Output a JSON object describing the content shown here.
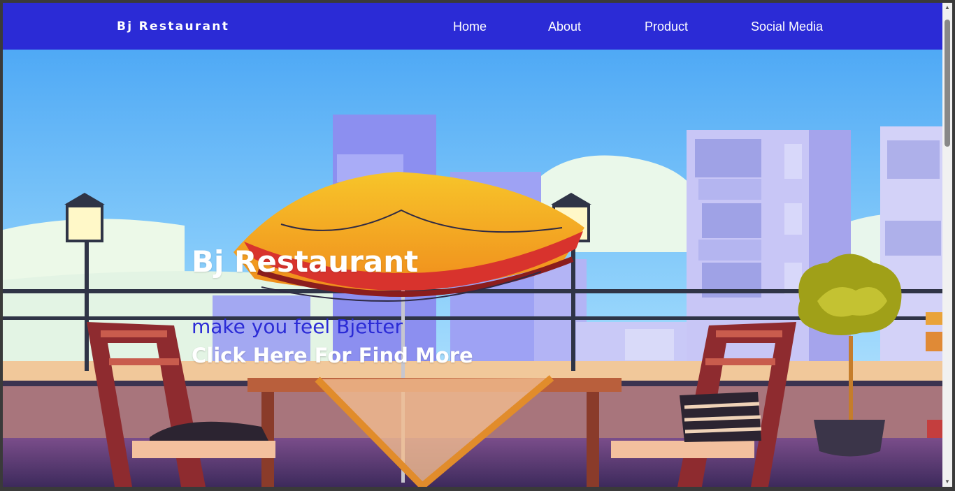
{
  "navbar": {
    "brand": "Bj Restaurant",
    "links": [
      "Home",
      "About",
      "Product",
      "Social Media"
    ]
  },
  "hero": {
    "title": "Bj Restaurant",
    "tagline": "make you feel Bjetter",
    "cta": "Click Here For Find More"
  },
  "colors": {
    "navbar_bg": "#2b2bd6",
    "tagline": "#2b2bd6",
    "text_light": "#ffffff"
  },
  "icons": [
    "chevron-up-icon",
    "chevron-down-icon"
  ]
}
